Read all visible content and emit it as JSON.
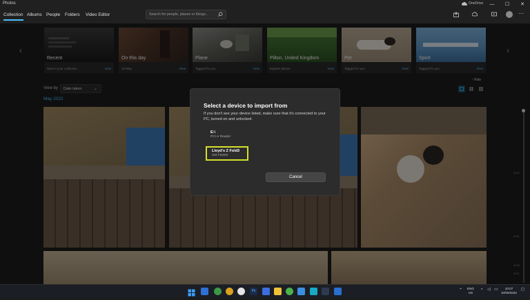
{
  "app": {
    "title": "Photos"
  },
  "nav": {
    "tabs": [
      {
        "label": "Collection",
        "active": true
      },
      {
        "label": "Albums"
      },
      {
        "label": "People"
      },
      {
        "label": "Folders"
      },
      {
        "label": "Video Editor"
      }
    ]
  },
  "search": {
    "placeholder": "Search for people, places or things..."
  },
  "account": {
    "onedrive_label": "OneDrive"
  },
  "cards": [
    {
      "title": "Recent",
      "subtitle": "New in your collection",
      "link": "View"
    },
    {
      "title": "On this day",
      "subtitle": "10 May",
      "link": "View"
    },
    {
      "title": "Plane",
      "subtitle": "Tagged for you",
      "link": "View"
    },
    {
      "title": "Pilton, United Kingdom",
      "subtitle": "Explore places",
      "link": "View"
    },
    {
      "title": "Pet",
      "subtitle": "Tagged for you",
      "link": "View"
    },
    {
      "title": "Sport",
      "subtitle": "Tagged for you",
      "link": "View"
    }
  ],
  "toolbar": {
    "hide_label": "Hide",
    "viewby_label": "View by",
    "viewby_value": "Date taken"
  },
  "gallery": {
    "month_label": "May 2022"
  },
  "timeline": {
    "years": [
      "2022",
      "2021",
      "2020",
      "2017"
    ]
  },
  "dialog": {
    "title": "Select a device to import from",
    "description": "If you don't see your device listed, make sure that it's connected to your PC, turned on and unlocked.",
    "devices": [
      {
        "name": "E:\\",
        "type": "PCI-e Reader"
      },
      {
        "name": "Lloyd's Z Fold3",
        "type": "SM-F926N",
        "selected": true
      }
    ],
    "cancel_label": "Cancel",
    "highlight_color": "#d3e22c"
  },
  "taskbar": {
    "language": "ENG",
    "region": "US",
    "time": "10:07",
    "date": "10/05/2022"
  },
  "colors": {
    "accent": "#4cc2ff",
    "background": "#1c1c1c",
    "dialog": "#2c2c2c"
  }
}
